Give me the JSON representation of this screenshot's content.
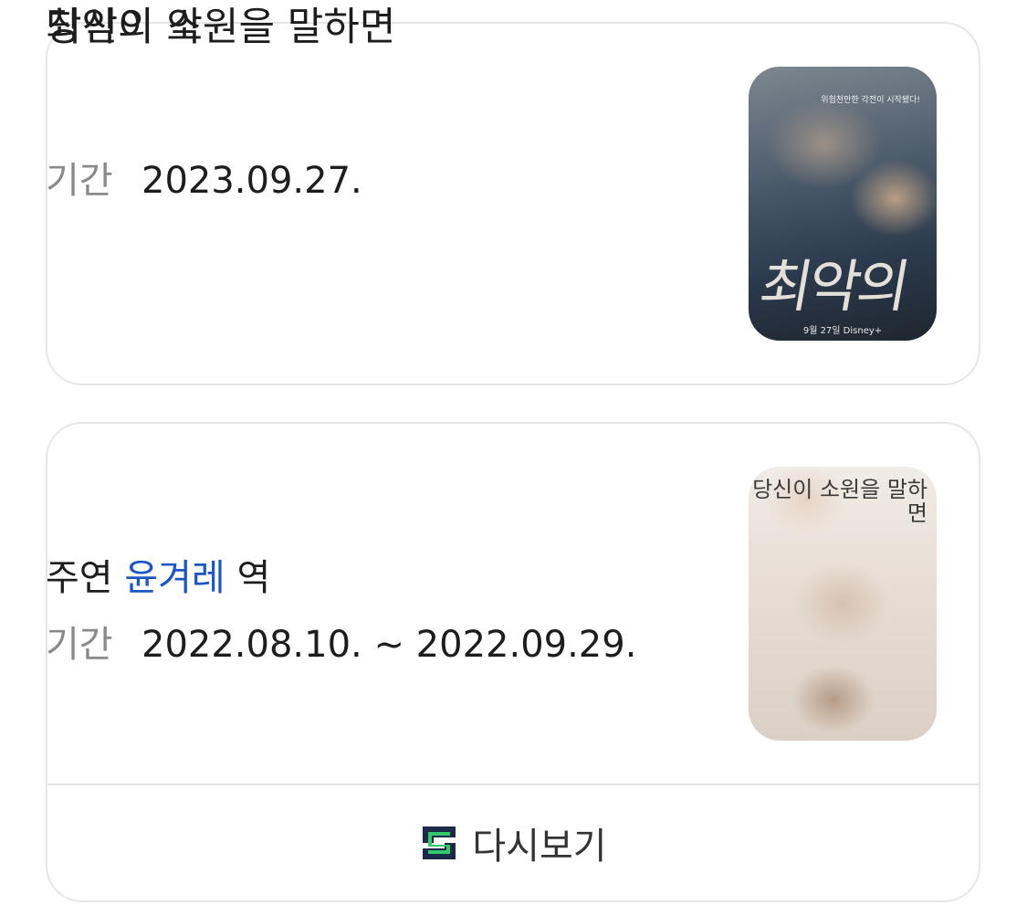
{
  "cards": [
    {
      "title": "최악의 악",
      "period_label": "기간",
      "period_value": "2023.09.27.",
      "poster": {
        "title_art": "최악의 악",
        "tagline": "위험천만한 각전이 시작됐다!",
        "release": "9월 27일   Disney+"
      }
    },
    {
      "title": "당신이 소원을 말하면",
      "cast_label": "주연",
      "cast_name": "윤겨레",
      "cast_suffix": "역",
      "period_label": "기간",
      "period_value": "2022.08.10. ~ 2022.09.29.",
      "poster": {
        "title_art": "당신이 소원을 말하면"
      }
    }
  ],
  "replay": {
    "label": "다시보기",
    "icon": "play-logo-icon",
    "icon_colors": [
      "#1c2a4a",
      "#31c96a"
    ]
  }
}
